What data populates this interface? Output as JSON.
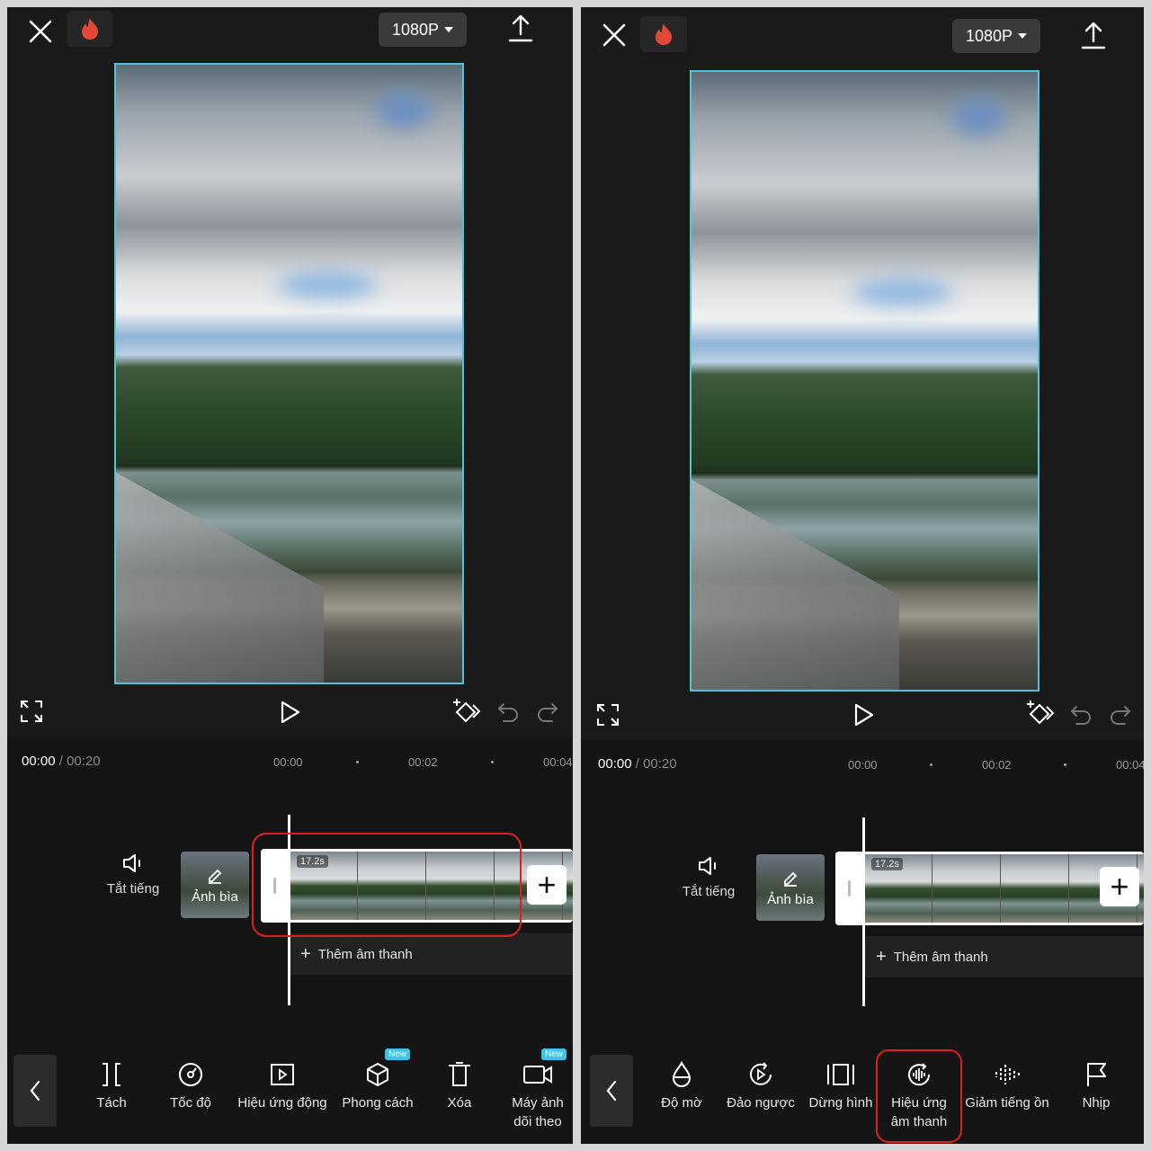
{
  "left": {
    "resolution": "1080P",
    "time_current": "00:00",
    "time_separator": "/",
    "time_total": "00:20",
    "ruler": [
      "00:00",
      "00:02",
      "00:04"
    ],
    "mute_label": "Tắt tiếng",
    "cover_label": "Ảnh bìa",
    "clip_duration": "17.2s",
    "add_audio_label": "Thêm âm thanh",
    "tools": [
      {
        "label": "Tách",
        "icon": "split-icon"
      },
      {
        "label": "Tốc độ",
        "icon": "speed-icon"
      },
      {
        "label": "Hiệu ứng động",
        "icon": "animation-icon"
      },
      {
        "label": "Phong cách",
        "icon": "style-cube-icon",
        "badge": "New"
      },
      {
        "label": "Xóa",
        "icon": "delete-icon"
      },
      {
        "label": "Máy ảnh dõi theo",
        "icon": "camera-track-icon",
        "badge": "New"
      }
    ]
  },
  "right": {
    "resolution": "1080P",
    "time_current": "00:00",
    "time_separator": "/",
    "time_total": "00:20",
    "ruler": [
      "00:00",
      "00:02",
      "00:04"
    ],
    "mute_label": "Tắt tiếng",
    "cover_label": "Ảnh bìa",
    "clip_duration": "17.2s",
    "add_audio_label": "Thêm âm thanh",
    "tools": [
      {
        "label": "Độ mờ",
        "icon": "opacity-drop-icon"
      },
      {
        "label": "Đảo ngược",
        "icon": "reverse-icon"
      },
      {
        "label": "Dừng hình",
        "icon": "freeze-frame-icon"
      },
      {
        "label": "Hiệu ứng âm thanh",
        "icon": "voice-effect-icon"
      },
      {
        "label": "Giảm tiếng ồn",
        "icon": "noise-reduce-icon"
      },
      {
        "label": "Nhịp",
        "icon": "beat-flag-icon"
      }
    ]
  },
  "colors": {
    "accent_border": "#4fc3dd",
    "highlight": "#e02020",
    "badge": "#37c6e8",
    "background": "#1a1a1a"
  }
}
